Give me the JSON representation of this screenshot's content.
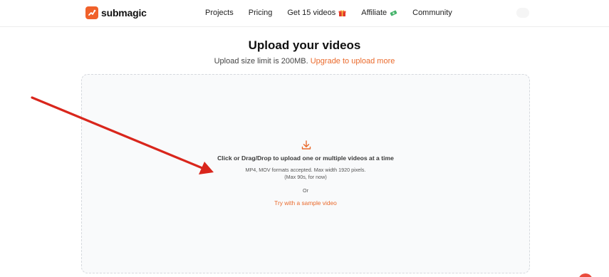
{
  "brand": {
    "name": "submagic",
    "color": "#f0612a"
  },
  "nav": {
    "items": [
      {
        "label": "Projects",
        "emoji": ""
      },
      {
        "label": "Pricing",
        "emoji": ""
      },
      {
        "label": "Get 15 videos",
        "emoji": "gift-icon"
      },
      {
        "label": "Affiliate",
        "emoji": "money-icon"
      },
      {
        "label": "Community",
        "emoji": ""
      }
    ]
  },
  "upload": {
    "title": "Upload your videos",
    "size_limit_text": "Upload size limit is 200MB.",
    "upgrade_link": "Upgrade to upload more",
    "dropzone": {
      "icon": "download-icon",
      "main_text": "Click or Drag/Drop to upload one or multiple videos at a time",
      "formats_text": "MP4, MOV formats accepted. Max width 1920 pixels.",
      "limit_text": "(Max 90s, for now)",
      "or_text": "Or",
      "sample_link": "Try with a sample video"
    }
  },
  "colors": {
    "accent": "#ea6a2c",
    "annotation_arrow": "#d9261c"
  }
}
